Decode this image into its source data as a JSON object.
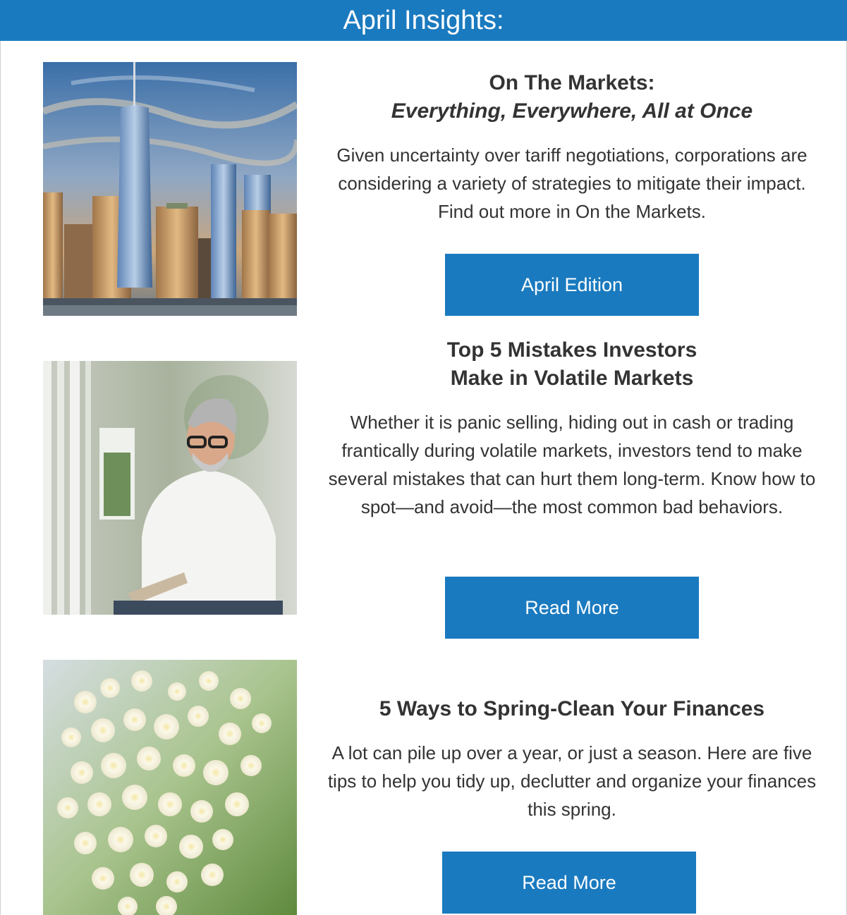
{
  "header": {
    "title": "April Insights:"
  },
  "articles": [
    {
      "image": "city-skyline-photo",
      "title": "On The Markets:",
      "subtitle": "Everything, Everywhere, All at Once",
      "summary": "Given uncertainty over tariff negotiations, corporations are considering a variety of strategies to mitigate their impact. Find out more in On the Markets.",
      "button_label": "April Edition"
    },
    {
      "image": "man-with-tablet-photo",
      "title_line1": "Top 5 Mistakes Investors",
      "title_line2": "Make in Volatile Markets",
      "summary": "Whether it is panic selling, hiding out in cash or trading frantically during volatile markets, investors tend to make several mistakes that can hurt them long-term. Know how to spot—and avoid—the most common bad behaviors.",
      "button_label": "Read More"
    },
    {
      "image": "white-flowers-photo",
      "title": "5 Ways to Spring-Clean Your Finances",
      "summary": "A lot can pile up over a year, or just a season. Here are five tips to help you tidy up, declutter and organize your finances this spring.",
      "button_label": "Read More"
    }
  ],
  "colors": {
    "accent": "#1a7abf",
    "text": "#333333",
    "background": "#ffffff"
  }
}
